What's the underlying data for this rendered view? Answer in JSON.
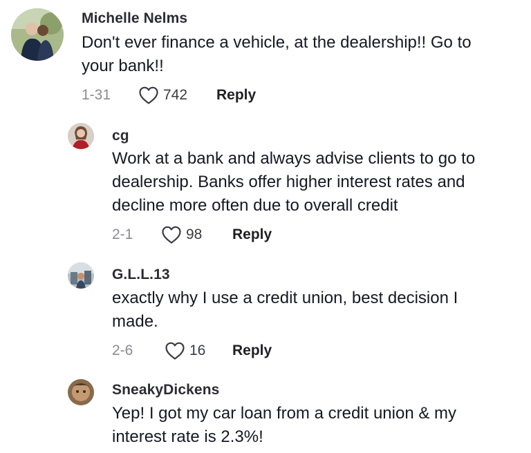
{
  "comments": [
    {
      "username": "Michelle Nelms",
      "lines": [
        "Don't ever finance a vehicle, at the dealership!! Go to",
        "your bank!!"
      ],
      "date": "1-31",
      "likes": "742",
      "reply_label": "Reply"
    },
    {
      "username": "cg",
      "lines": [
        "Work at a bank and always advise clients to go to",
        "dealership. Banks offer higher interest rates and",
        "decline more often due to overall credit"
      ],
      "date": "2-1",
      "likes": "98",
      "reply_label": "Reply"
    },
    {
      "username": "G.L.L.13",
      "lines": [
        "exactly why I use a credit union, best decision I",
        "made."
      ],
      "date": "2-6",
      "likes": "16",
      "reply_label": "Reply"
    },
    {
      "username": "SneakyDickens",
      "lines": [
        "Yep! I got my car loan from a credit union & my",
        "interest rate is 2.3%!"
      ]
    }
  ],
  "icons": {
    "like": "heart-outline-icon"
  }
}
